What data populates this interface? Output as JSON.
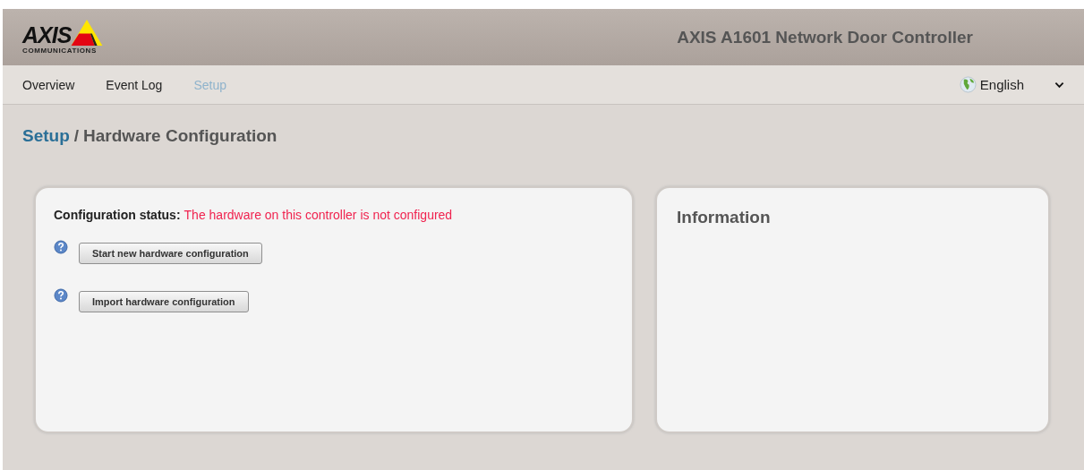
{
  "logo": {
    "wordmark": "AXIS",
    "tagline": "COMMUNICATIONS"
  },
  "header": {
    "title": "AXIS A1601 Network Door Controller"
  },
  "nav": [
    {
      "label": "Overview",
      "selected": false
    },
    {
      "label": "Event Log",
      "selected": false
    },
    {
      "label": "Setup",
      "selected": true
    }
  ],
  "language": {
    "value": "English"
  },
  "breadcrumb": {
    "parent": "Setup",
    "separator": "/",
    "current": "Hardware Configuration"
  },
  "config_panel": {
    "status_label": "Configuration status:",
    "status_text": "The hardware on this controller is not configured",
    "actions": [
      {
        "label": "Start new hardware configuration"
      },
      {
        "label": "Import hardware configuration"
      }
    ]
  },
  "info_panel": {
    "title": "Information"
  }
}
